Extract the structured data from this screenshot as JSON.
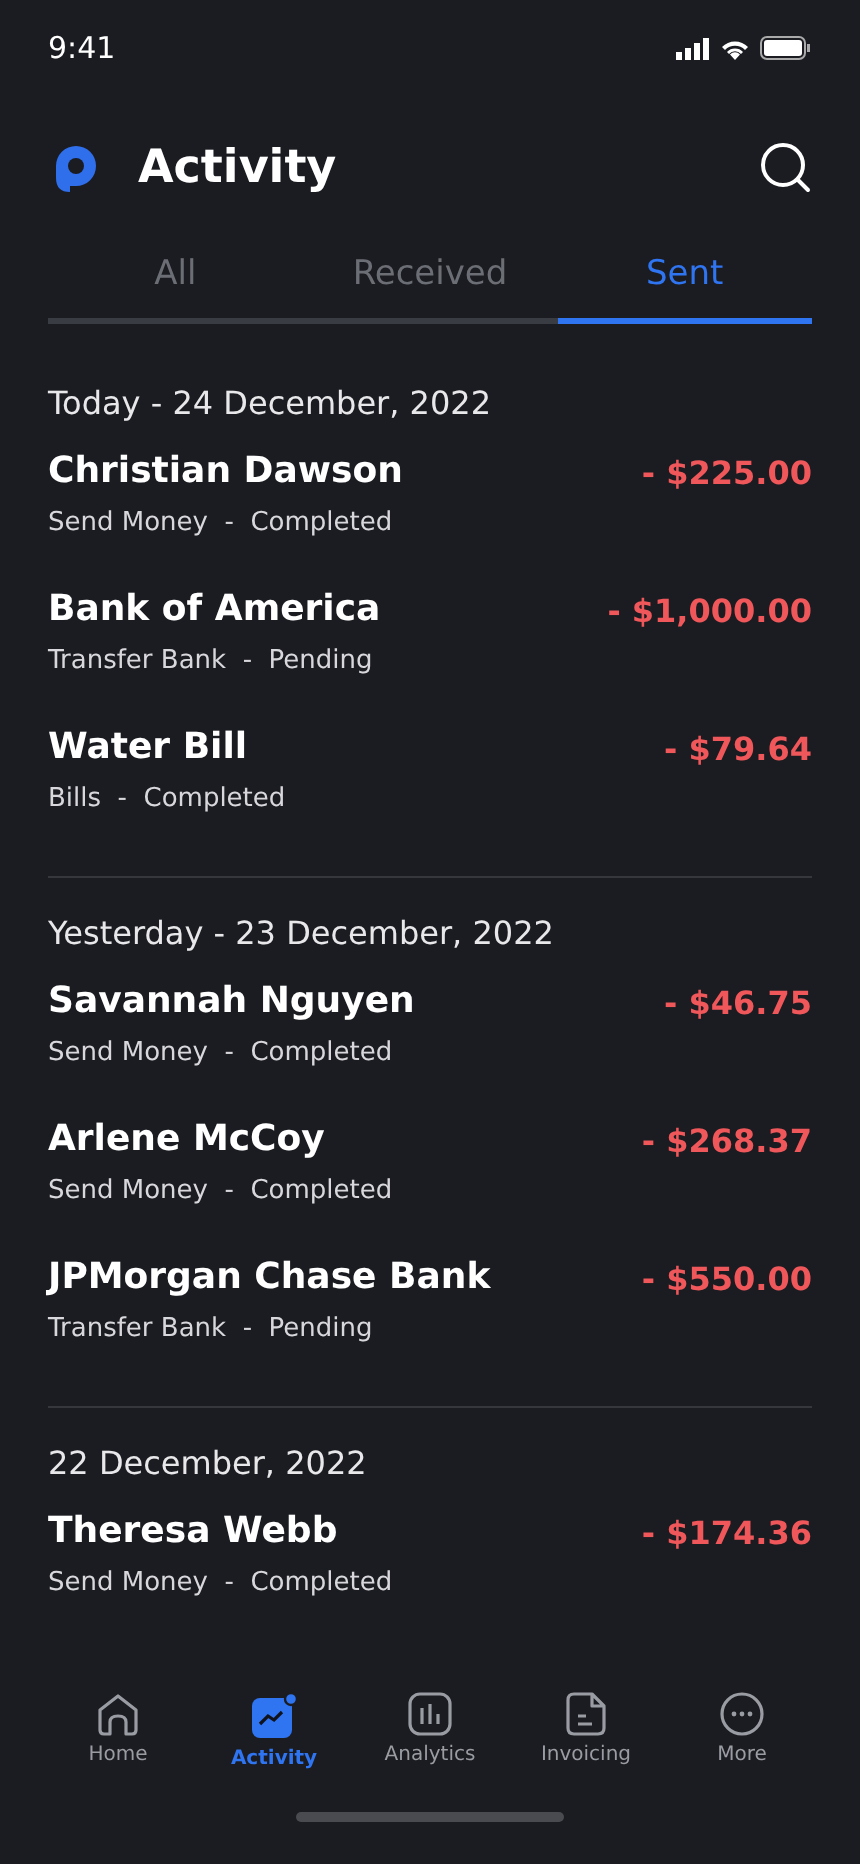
{
  "status_bar": {
    "time": "9:41"
  },
  "header": {
    "title": "Activity"
  },
  "tabs": [
    {
      "label": "All",
      "selected": false
    },
    {
      "label": "Received",
      "selected": false
    },
    {
      "label": "Sent",
      "selected": true
    }
  ],
  "groups": [
    {
      "date": "Today - 24 December, 2022",
      "transactions": [
        {
          "name": "Christian Dawson",
          "detail": "Send Money  -  Completed",
          "amount": "- $225.00"
        },
        {
          "name": "Bank of America",
          "detail": "Transfer Bank  -  Pending",
          "amount": "- $1,000.00"
        },
        {
          "name": "Water Bill",
          "detail": "Bills  -  Completed",
          "amount": "- $79.64"
        }
      ]
    },
    {
      "date": "Yesterday - 23 December, 2022",
      "transactions": [
        {
          "name": "Savannah Nguyen",
          "detail": "Send Money  -  Completed",
          "amount": "- $46.75"
        },
        {
          "name": "Arlene McCoy",
          "detail": "Send Money  -  Completed",
          "amount": "- $268.37"
        },
        {
          "name": "JPMorgan Chase Bank",
          "detail": "Transfer Bank  -  Pending",
          "amount": "- $550.00"
        }
      ]
    },
    {
      "date": "22 December, 2022",
      "transactions": [
        {
          "name": "Theresa Webb",
          "detail": "Send Money  -  Completed",
          "amount": "- $174.36"
        }
      ]
    }
  ],
  "nav": [
    {
      "kind": "home",
      "label": "Home",
      "selected": false
    },
    {
      "kind": "activity",
      "label": "Activity",
      "selected": true
    },
    {
      "kind": "analytics",
      "label": "Analytics",
      "selected": false
    },
    {
      "kind": "invoicing",
      "label": "Invoicing",
      "selected": false
    },
    {
      "kind": "more",
      "label": "More",
      "selected": false
    }
  ]
}
